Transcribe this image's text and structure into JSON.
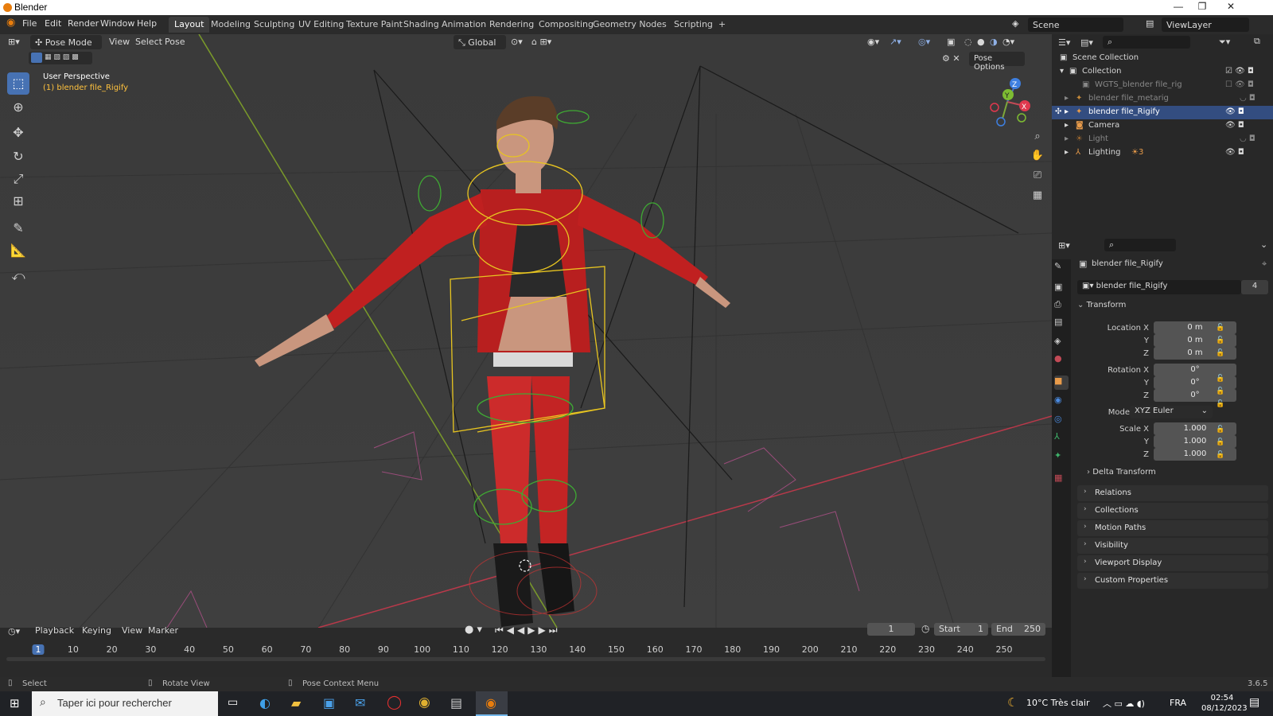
{
  "window": {
    "title": "Blender",
    "controls": [
      "—",
      "❐",
      "✕"
    ]
  },
  "menu": {
    "items": [
      "File",
      "Edit",
      "Render",
      "Window",
      "Help"
    ],
    "workspaces": [
      "Layout",
      "Modeling",
      "Sculpting",
      "UV Editing",
      "Texture Paint",
      "Shading",
      "Animation",
      "Rendering",
      "Compositing",
      "Geometry Nodes",
      "Scripting",
      "+"
    ],
    "scene_label": "Scene",
    "viewlayer_label": "ViewLayer"
  },
  "viewport": {
    "mode": "Pose Mode",
    "menus": [
      "View",
      "Select",
      "Pose"
    ],
    "orientation": "Global",
    "pose_options": "Pose Options",
    "perspective": "User Perspective",
    "object": "(1) blender file_Rigify",
    "gizmo": {
      "x": "X",
      "y": "Y",
      "z": "Z"
    }
  },
  "outliner": {
    "root": "Scene Collection",
    "collection": "Collection",
    "items": [
      {
        "label": "WGTS_blender file_rig",
        "dim": true
      },
      {
        "label": "blender file_metarig",
        "dim": true
      },
      {
        "label": "blender file_Rigify",
        "selected": true
      },
      {
        "label": "Camera",
        "dim": false
      },
      {
        "label": "Light",
        "dim": true
      },
      {
        "label": "Lighting",
        "dim": false,
        "badge": "3"
      }
    ]
  },
  "properties": {
    "header_object": "blender file_Rigify",
    "data_name": "blender file_Rigify",
    "users": "4",
    "transform_title": "Transform",
    "location": {
      "label": "Location X",
      "x": "0 m",
      "y": "0 m",
      "z": "0 m"
    },
    "rotation": {
      "label": "Rotation X",
      "x": "0°",
      "y": "0°",
      "z": "0°"
    },
    "axis_y": "Y",
    "axis_z": "Z",
    "mode_label": "Mode",
    "mode_value": "XYZ Euler",
    "scale": {
      "label": "Scale X",
      "x": "1.000",
      "y": "1.000",
      "z": "1.000"
    },
    "delta": "Delta Transform",
    "panels": [
      "Relations",
      "Collections",
      "Motion Paths",
      "Visibility",
      "Viewport Display",
      "Custom Properties"
    ]
  },
  "timeline": {
    "menus": [
      "Playback",
      "Keying",
      "View",
      "Marker"
    ],
    "current_frame": "1",
    "start_label": "Start",
    "start": "1",
    "end_label": "End",
    "end": "250",
    "ticks": [
      "1",
      "10",
      "20",
      "30",
      "40",
      "50",
      "60",
      "70",
      "80",
      "90",
      "100",
      "110",
      "120",
      "130",
      "140",
      "150",
      "160",
      "170",
      "180",
      "190",
      "200",
      "210",
      "220",
      "230",
      "240",
      "250"
    ]
  },
  "status": {
    "select": "Select",
    "rotate": "Rotate View",
    "context": "Pose Context Menu",
    "version": "3.6.5"
  },
  "taskbar": {
    "search": "Taper ici pour rechercher",
    "weather": "10°C  Très clair",
    "lang": "FRA",
    "time": "02:54",
    "date": "08/12/2023"
  },
  "colors": {
    "accent": "#4772b3",
    "selected_row": "#334d80",
    "orange": "#e87d0d"
  }
}
